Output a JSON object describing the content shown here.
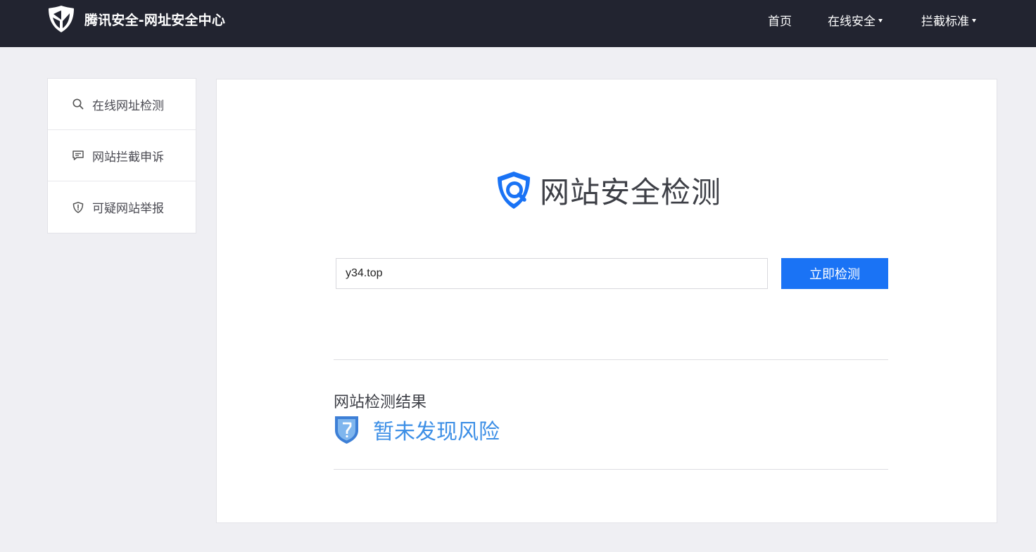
{
  "header": {
    "brand_title": "腾讯安全-网址安全中心",
    "logo_icon": "tencent-security-shield-logo",
    "nav": [
      {
        "label": "首页",
        "dropdown": false
      },
      {
        "label": "在线安全",
        "dropdown": true
      },
      {
        "label": "拦截标准",
        "dropdown": true
      }
    ]
  },
  "sidebar": {
    "items": [
      {
        "label": "在线网址检测",
        "icon": "search-icon"
      },
      {
        "label": "网站拦截申诉",
        "icon": "message-icon"
      },
      {
        "label": "可疑网站举报",
        "icon": "shield-alert-icon"
      }
    ]
  },
  "main": {
    "title": "网站安全检测",
    "title_icon": "shield-search-icon",
    "url_input": {
      "value": "y34.top",
      "placeholder": ""
    },
    "check_button_label": "立即检测",
    "result": {
      "label": "网站检测结果",
      "status": "暂未发现风险",
      "status_icon": "unknown-shield-icon"
    }
  },
  "colors": {
    "header_bg": "#222430",
    "page_bg": "#efeff3",
    "accent": "#1a73f5",
    "result_text": "#3d8fe6"
  }
}
